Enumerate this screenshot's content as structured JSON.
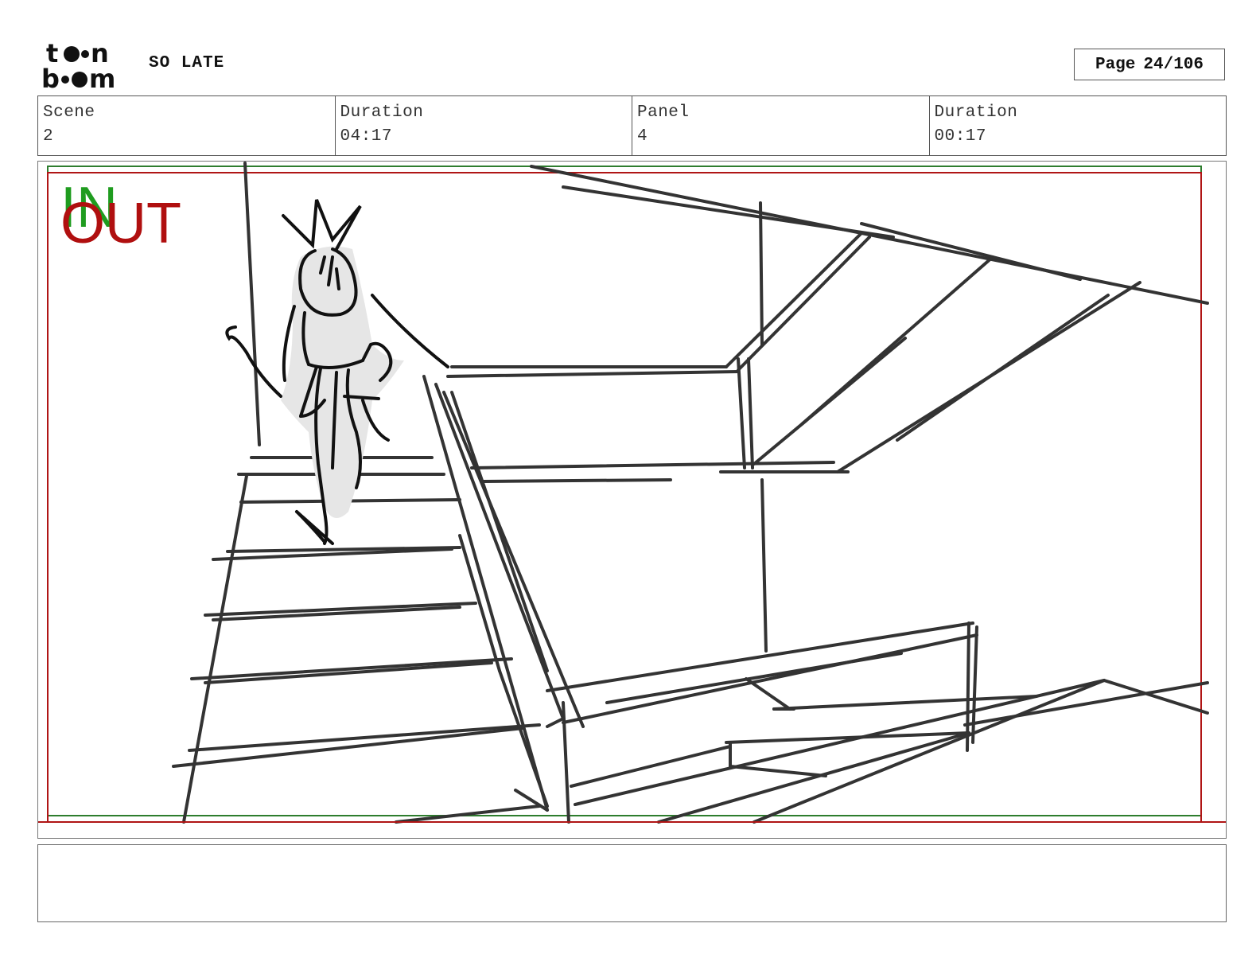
{
  "header": {
    "logo_text_top": "toon",
    "logo_text_bottom": "boom",
    "project_title": "SO LATE",
    "page_label": "Page",
    "page_value": "24/106"
  },
  "info": {
    "scene_label": "Scene",
    "scene_value": "2",
    "scene_duration_label": "Duration",
    "scene_duration_value": "04:17",
    "panel_label": "Panel",
    "panel_value": "4",
    "panel_duration_label": "Duration",
    "panel_duration_value": "00:17"
  },
  "panel": {
    "in_label": "IN",
    "out_label": "OUT",
    "in_color": "#1f9c1f",
    "out_color": "#b00f0f"
  },
  "notes": {
    "text": ""
  }
}
